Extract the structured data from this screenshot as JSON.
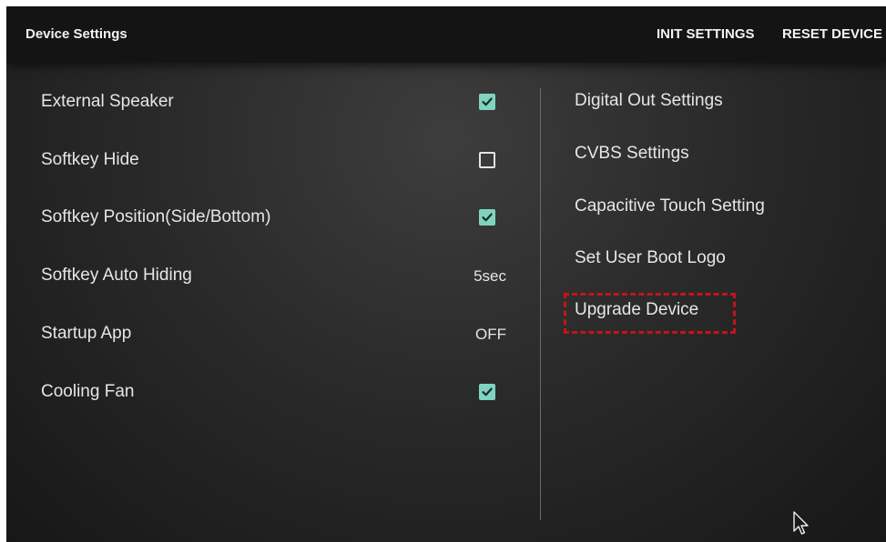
{
  "header": {
    "title": "Device Settings",
    "actions": [
      {
        "label": "INIT SETTINGS"
      },
      {
        "label": "RESET DEVICE"
      }
    ]
  },
  "left_settings": [
    {
      "label": "External Speaker",
      "control": "checkbox",
      "checked": true
    },
    {
      "label": "Softkey Hide",
      "control": "checkbox",
      "checked": false
    },
    {
      "label": "Softkey Position(Side/Bottom)",
      "control": "checkbox",
      "checked": true
    },
    {
      "label": "Softkey Auto Hiding",
      "control": "value",
      "value": "5sec"
    },
    {
      "label": "Startup App",
      "control": "value",
      "value": "OFF"
    },
    {
      "label": "Cooling Fan",
      "control": "checkbox",
      "checked": true
    }
  ],
  "right_menu": [
    {
      "label": "Digital Out Settings"
    },
    {
      "label": "CVBS Settings"
    },
    {
      "label": "Capacitive Touch Setting"
    },
    {
      "label": "Set User Boot Logo"
    },
    {
      "label": "Upgrade Device",
      "highlighted": true
    }
  ],
  "colors": {
    "checkbox_checked": "#7fd4c1",
    "highlight": "#c8121b",
    "topbar": "#141414"
  }
}
